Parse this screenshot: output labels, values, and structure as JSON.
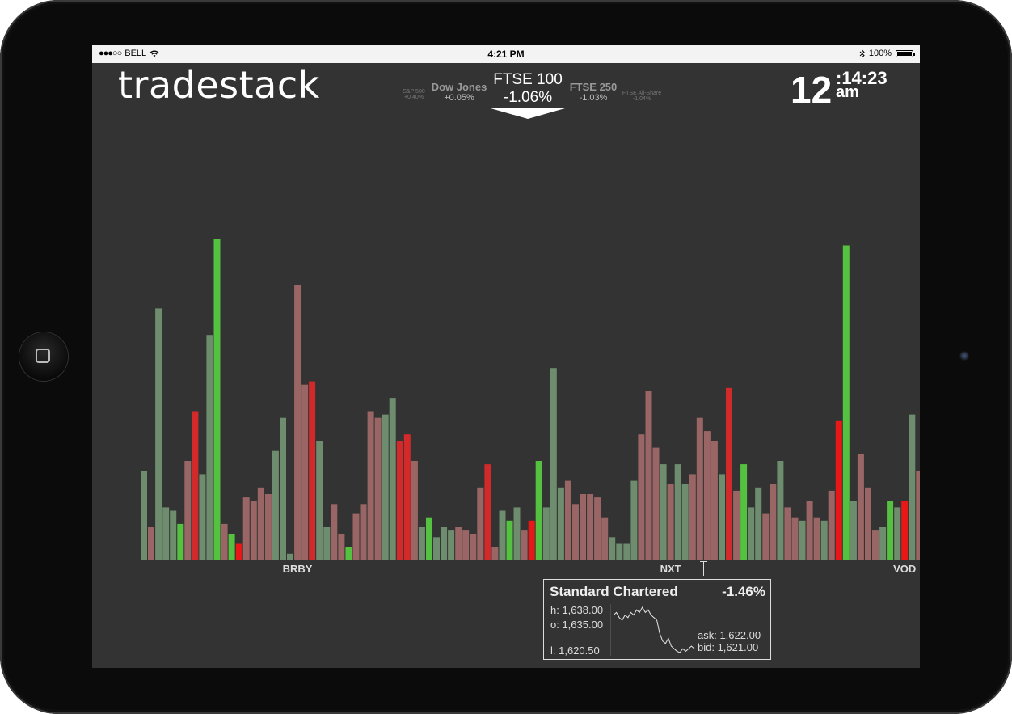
{
  "status_bar": {
    "signal": "●●●○○",
    "carrier": "BELL",
    "time": "4:21 PM",
    "battery": "100%"
  },
  "app": {
    "logo": "tradestack"
  },
  "indices": {
    "sp500": {
      "name": "S&P 500",
      "change": "+0.40%"
    },
    "dow": {
      "name": "Dow Jones",
      "change": "+0.05%"
    },
    "ftse100": {
      "name": "FTSE 100",
      "change": "-1.06%"
    },
    "ftse250": {
      "name": "FTSE 250",
      "change": "-1.03%"
    },
    "ftse_all": {
      "name": "FTSE All-Share",
      "change": "-1.04%"
    }
  },
  "clock": {
    "hour": "12",
    "min_sec": ":14:23",
    "ampm": "am"
  },
  "chart_data": {
    "type": "bar",
    "labels": [
      {
        "text": "BRBY",
        "index": 21
      },
      {
        "text": "NXT",
        "index": 72
      },
      {
        "text": "VOD",
        "index": 104
      }
    ],
    "values": [
      27,
      10,
      76,
      16,
      15,
      11,
      30,
      45,
      26,
      68,
      97,
      11,
      8,
      5,
      19,
      18,
      22,
      20,
      33,
      43,
      2,
      83,
      53,
      54,
      36,
      10,
      17,
      8,
      4,
      14,
      17,
      45,
      43,
      44,
      49,
      36,
      38,
      30,
      10,
      13,
      7,
      10,
      9,
      10,
      9,
      8,
      22,
      29,
      4,
      15,
      12,
      16,
      9,
      12,
      30,
      16,
      58,
      22,
      24,
      17,
      20,
      20,
      19,
      13,
      7,
      5,
      5,
      24,
      38,
      51,
      34,
      29,
      23,
      29,
      23,
      26,
      43,
      39,
      36,
      26,
      52,
      21,
      29,
      16,
      22,
      14,
      23,
      30,
      16,
      13,
      12,
      18,
      13,
      12,
      21,
      42,
      95,
      18,
      32,
      22,
      9,
      10,
      18,
      16,
      18,
      44,
      27
    ],
    "colors": [
      "gm",
      "rm",
      "gm",
      "gm",
      "gm",
      "gb",
      "rm",
      "rd",
      "gm",
      "gm",
      "gb",
      "rm",
      "gb",
      "rb",
      "rm",
      "rm",
      "rm",
      "rm",
      "gm",
      "gm",
      "gm",
      "rm",
      "rm",
      "rd",
      "gm",
      "gm",
      "rm",
      "rm",
      "gb",
      "rm",
      "rm",
      "rm",
      "rm",
      "gm",
      "gm",
      "rd",
      "rd",
      "rm",
      "gm",
      "gb",
      "gm",
      "gm",
      "gm",
      "rm",
      "rm",
      "rm",
      "rm",
      "rd",
      "rm",
      "gm",
      "gb",
      "gm",
      "rm",
      "rb",
      "gb",
      "gm",
      "gm",
      "gm",
      "rm",
      "rm",
      "rm",
      "rm",
      "rm",
      "rm",
      "gm",
      "gm",
      "gm",
      "gm",
      "rm",
      "rm",
      "rm",
      "gm",
      "rm",
      "gm",
      "gm",
      "rm",
      "rm",
      "rm",
      "rm",
      "gm",
      "rd",
      "rm",
      "gb",
      "gm",
      "gm",
      "rm",
      "rm",
      "gm",
      "rm",
      "rm",
      "gm",
      "rm",
      "rm",
      "gm",
      "rm",
      "rb",
      "gb",
      "gm",
      "rm",
      "rm",
      "rm",
      "gm",
      "gb",
      "gm",
      "rb",
      "gm",
      "rm"
    ],
    "selected_index": 85
  },
  "tooltip": {
    "name": "Standard Chartered",
    "change": "-1.46%",
    "high": "h: 1,638.00",
    "open": "o: 1,635.00",
    "low": "l:  1,620.50",
    "ask": "ask: 1,622.00",
    "bid": "bid: 1,621.00",
    "sparkline": [
      1635,
      1636,
      1634,
      1633,
      1635,
      1634,
      1636,
      1635,
      1637,
      1636,
      1638,
      1636,
      1637,
      1635,
      1634,
      1633,
      1628,
      1625,
      1624,
      1626,
      1623,
      1622,
      1621,
      1620.5,
      1622,
      1621,
      1622,
      1623,
      1622
    ]
  },
  "colors": {
    "gm": "#6e8c6e",
    "rm": "#9a6565",
    "gb": "#55c140",
    "rb": "#e81818",
    "gd": "#8bb07a",
    "rd": "#d22a2a",
    "bg": "#333333"
  }
}
